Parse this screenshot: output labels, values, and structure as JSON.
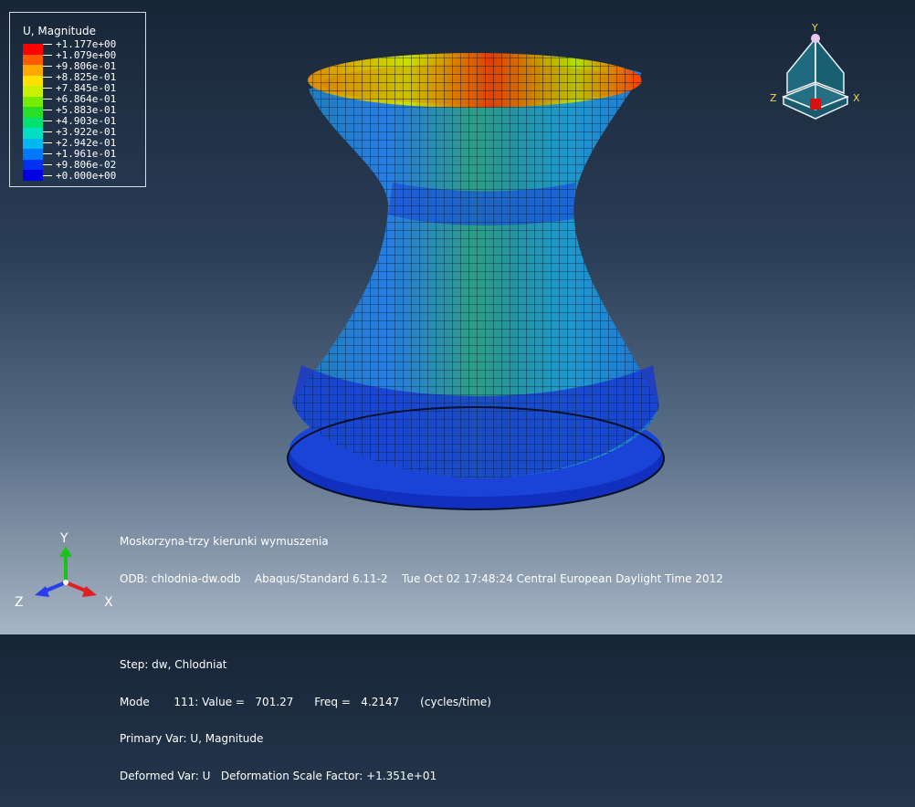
{
  "legend": {
    "title": "U, Magnitude",
    "values": [
      "+1.177e+00",
      "+1.079e+00",
      "+9.806e-01",
      "+8.825e-01",
      "+7.845e-01",
      "+6.864e-01",
      "+5.883e-01",
      "+4.903e-01",
      "+3.922e-01",
      "+2.942e-01",
      "+1.961e-01",
      "+9.806e-02",
      "+0.000e+00"
    ],
    "colors": [
      "#ff0000",
      "#ff5a00",
      "#ffa800",
      "#ffe000",
      "#c8f000",
      "#78ec00",
      "#28e028",
      "#00e070",
      "#00e0c0",
      "#00b8f0",
      "#0078f8",
      "#0030f0",
      "#0000e0"
    ]
  },
  "info": {
    "line1": "Moskorzyna-trzy kierunki wymuszenia",
    "line2": "ODB: chlodnia-dw.odb    Abaqus/Standard 6.11-2    Tue Oct 02 17:48:24 Central European Daylight Time 2012",
    "line3": "Step: dw, Chlodniat",
    "line4": "Mode       111: Value =   701.27      Freq =   4.2147      (cycles/time)",
    "line5": "Primary Var: U, Magnitude",
    "line6": "Deformed Var: U   Deformation Scale Factor: +1.351e+01"
  },
  "triad_main": {
    "x": "X",
    "y": "Y",
    "z": "Z"
  },
  "triad_view": {
    "x": "X",
    "y": "Y",
    "z": "Z"
  }
}
